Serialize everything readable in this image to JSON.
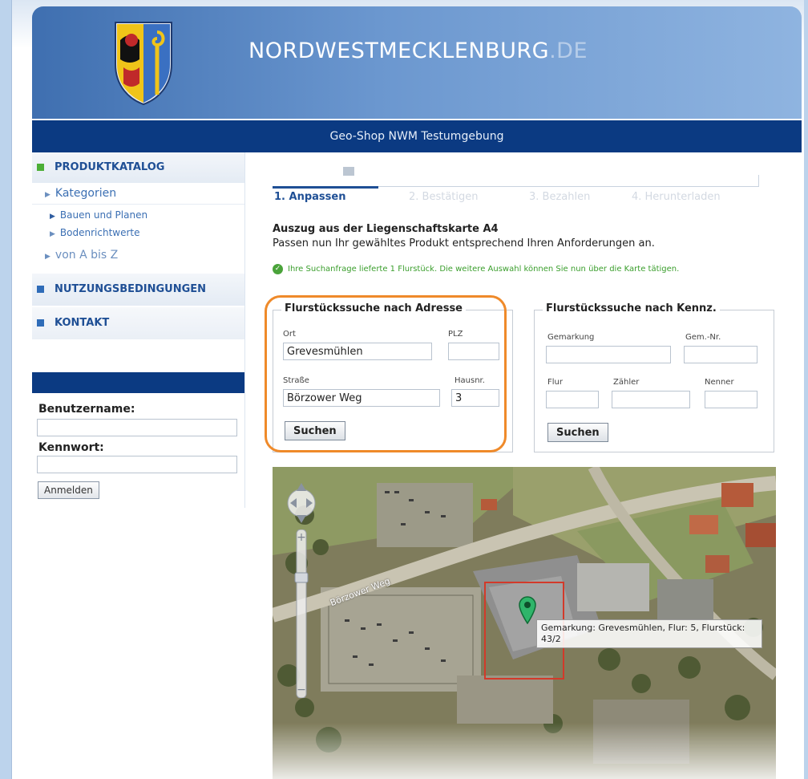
{
  "header": {
    "site_name": "NORDWESTMECKLENBURG",
    "site_tld": ".DE",
    "subtitle": "Geo-Shop NWM Testumgebung"
  },
  "sidebar": {
    "sections": [
      {
        "label": "PRODUKTKATALOG",
        "color": "#4caf37"
      },
      {
        "label": "NUTZUNGSBEDINGUNGEN",
        "color": "#2f6cb8"
      },
      {
        "label": "KONTAKT",
        "color": "#2f6cb8"
      }
    ],
    "kategorien": "Kategorien",
    "sub_items": [
      "Bauen und Planen",
      "Bodenrichtwerte"
    ],
    "a_bis_z": "von A bis Z",
    "login": {
      "username_label": "Benutzername:",
      "password_label": "Kennwort:",
      "button": "Anmelden"
    }
  },
  "steps": [
    {
      "label": "1. Anpassen",
      "active": true
    },
    {
      "label": "2. Bestätigen",
      "active": false
    },
    {
      "label": "3. Bezahlen",
      "active": false
    },
    {
      "label": "4. Herunterladen",
      "active": false
    }
  ],
  "product": {
    "title": "Auszug aus der Liegenschaftskarte A4",
    "description": "Passen nun Ihr gewähltes Produkt entsprechend Ihren Anforderungen an."
  },
  "success_message": "Ihre Suchanfrage lieferte 1 Flurstück. Die weitere Auswahl können Sie nun über die Karte tätigen.",
  "search_address": {
    "legend": "Flurstückssuche nach Adresse",
    "ort_label": "Ort",
    "ort_value": "Grevesmühlen",
    "plz_label": "PLZ",
    "plz_value": "",
    "strasse_label": "Straße",
    "strasse_value": "Börzower Weg",
    "hausnr_label": "Hausnr.",
    "hausnr_value": "3",
    "button": "Suchen"
  },
  "search_kennz": {
    "legend": "Flurstückssuche nach Kennz.",
    "gemarkung_label": "Gemarkung",
    "gemnr_label": "Gem.-Nr.",
    "flur_label": "Flur",
    "zaehler_label": "Zähler",
    "nenner_label": "Nenner",
    "button": "Suchen"
  },
  "map": {
    "road_label": "Börzower Weg",
    "tooltip": "Gemarkung: Grevesmühlen, Flur: 5, Flurstück: 43/2"
  },
  "colors": {
    "header_blue": "#0b3a82",
    "highlight": "#ef8a2a",
    "success_green": "#3a9e2c"
  }
}
